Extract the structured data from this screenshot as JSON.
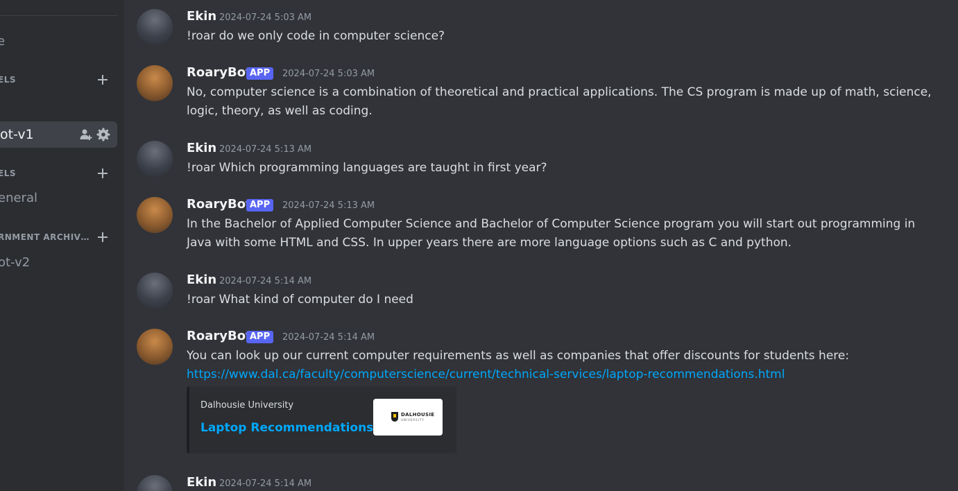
{
  "sidebar": {
    "items": [
      {
        "type": "channel",
        "label": "e"
      },
      {
        "type": "category",
        "label": "ELS"
      },
      {
        "type": "active-channel",
        "label": "ot-v1"
      },
      {
        "type": "category",
        "label": "ELS"
      },
      {
        "type": "channel",
        "label": "eneral"
      },
      {
        "type": "category",
        "label": "RNMENT ARCHIV…"
      },
      {
        "type": "channel",
        "label": "ot-v2"
      }
    ],
    "icons": {
      "add": "plus-icon",
      "invite": "add-member-icon",
      "settings": "gear-icon"
    }
  },
  "app_badge": "APP",
  "messages": [
    {
      "author": "Ekin",
      "is_bot": false,
      "timestamp": "2024-07-24 5:03 AM",
      "text": "!roar do we only code in computer science?"
    },
    {
      "author": "RoaryBot",
      "is_bot": true,
      "timestamp": "2024-07-24 5:03 AM",
      "text": "No, computer science is a combination of theoretical and practical applications. The CS program is made up of math, science, logic, theory, as well as coding."
    },
    {
      "author": "Ekin",
      "is_bot": false,
      "timestamp": "2024-07-24 5:13 AM",
      "text": "!roar Which programming languages are taught in first year?"
    },
    {
      "author": "RoaryBot",
      "is_bot": true,
      "timestamp": "2024-07-24 5:13 AM",
      "text": "In the Bachelor of Applied Computer Science and Bachelor of Computer Science program you will start out programming in Java with some HTML and CSS. In upper years there are more language options such as C and python."
    },
    {
      "author": "Ekin",
      "is_bot": false,
      "timestamp": "2024-07-24 5:14 AM",
      "text": "!roar What kind of computer do I need"
    },
    {
      "author": "RoaryBot",
      "is_bot": true,
      "timestamp": "2024-07-24 5:14 AM",
      "text": "You can look up our current computer requirements as well as companies that offer discounts for students here:",
      "link": "https://www.dal.ca/faculty/computerscience/current/technical-services/laptop-recommendations.html",
      "embed": {
        "provider": "Dalhousie University",
        "title": "Laptop Recommendations",
        "thumbnail_logo_text": "DALHOUSIE",
        "thumbnail_logo_sub": "UNIVERSITY"
      }
    },
    {
      "author": "Ekin",
      "is_bot": false,
      "timestamp": "2024-07-24 5:14 AM",
      "text": ""
    }
  ],
  "colors": {
    "background": "#313338",
    "sidebar": "#2b2d31",
    "app_badge": "#5865f2",
    "link": "#00a8fc",
    "timestamp": "#949ba4"
  }
}
